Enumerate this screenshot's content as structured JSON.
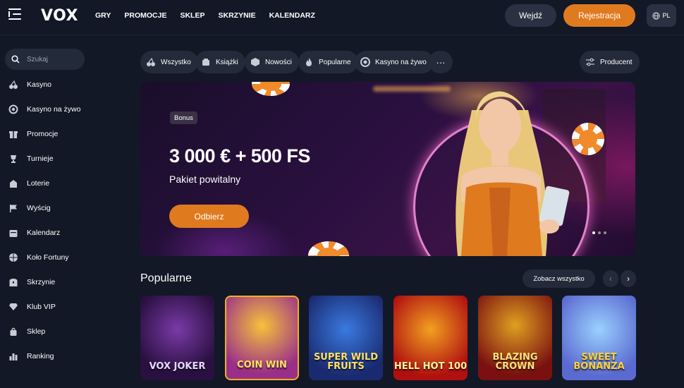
{
  "header": {
    "logo": "VOX",
    "nav": [
      "GRY",
      "PROMOCJE",
      "SKLEP",
      "SKRZYNIE",
      "KALENDARZ"
    ],
    "login_label": "Wejdź",
    "register_label": "Rejestracja",
    "lang": "PL"
  },
  "sidebar": {
    "search_placeholder": "Szukaj",
    "items": [
      {
        "label": "Kasyno",
        "icon": "cherries-icon"
      },
      {
        "label": "Kasyno na żywo",
        "icon": "chip-icon"
      },
      {
        "label": "Promocje",
        "icon": "gift-icon"
      },
      {
        "label": "Turnieje",
        "icon": "trophy-icon"
      },
      {
        "label": "Loterie",
        "icon": "lottery-icon"
      },
      {
        "label": "Wyścig",
        "icon": "flag-icon"
      },
      {
        "label": "Kalendarz",
        "icon": "calendar-icon"
      },
      {
        "label": "Koło Fortuny",
        "icon": "wheel-icon"
      },
      {
        "label": "Skrzynie",
        "icon": "chest-icon"
      },
      {
        "label": "Klub VIP",
        "icon": "diamond-icon"
      },
      {
        "label": "Sklep",
        "icon": "bag-icon"
      },
      {
        "label": "Ranking",
        "icon": "ranking-icon"
      }
    ]
  },
  "filters": [
    "Wszystko",
    "Książki",
    "Nowości",
    "Popularne",
    "Kasyno na żywo"
  ],
  "more_label": "···",
  "producer_label": "Producent",
  "banner": {
    "badge": "Bonus",
    "title": "3 000 € + 500 FS",
    "subtitle": "Pakiet powitalny",
    "button": "Odbierz"
  },
  "popular": {
    "title": "Popularne",
    "see_all": "Zobacz wszystko",
    "prev": "‹",
    "next": "›",
    "games": [
      {
        "name": "VOX JOKER"
      },
      {
        "name": "COIN WIN"
      },
      {
        "name": "SUPER WILD FRUITS"
      },
      {
        "name": "HELL HOT 100"
      },
      {
        "name": "BLAZING CROWN"
      },
      {
        "name": "SWEET BONANZA"
      }
    ]
  },
  "colors": {
    "accent": "#e07a1f",
    "background": "#121826",
    "surface": "#232a3a"
  }
}
